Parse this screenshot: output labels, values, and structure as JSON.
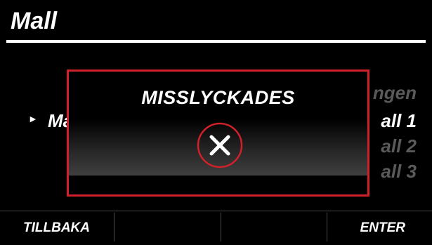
{
  "header": {
    "title": "Mall"
  },
  "background_list": {
    "selected_left": "Ma",
    "right_items": [
      "ngen",
      "all 1",
      "all 2",
      "all 3"
    ]
  },
  "dialog": {
    "title": "MISSLYCKADES",
    "icon": "close-x-circle-icon",
    "border_color": "#d0202a"
  },
  "softkeys": {
    "left": "TILLBAKA",
    "right": "ENTER"
  }
}
